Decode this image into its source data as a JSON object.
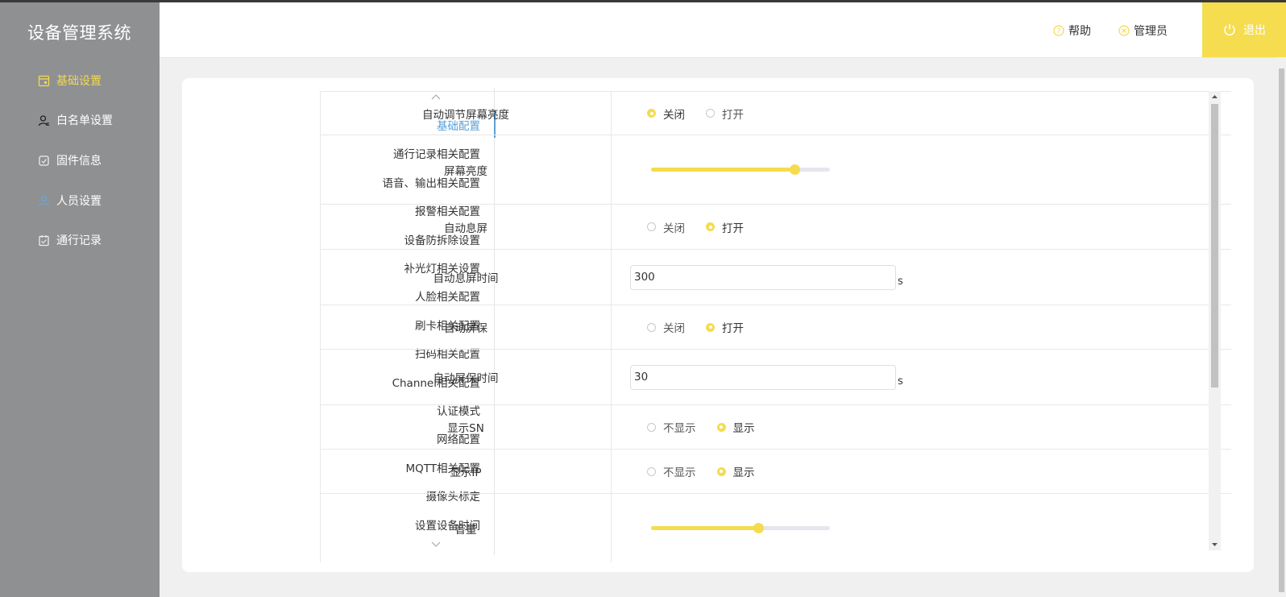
{
  "app": {
    "title": "设备管理系统"
  },
  "sidebar": {
    "items": [
      {
        "label": "基础设置",
        "icon": "settings-panel-icon",
        "active": true
      },
      {
        "label": "白名单设置",
        "icon": "user-list-icon",
        "active": false
      },
      {
        "label": "固件信息",
        "icon": "firmware-chip-icon",
        "active": false
      },
      {
        "label": "人员设置",
        "icon": "person-icon",
        "active": false
      },
      {
        "label": "通行记录",
        "icon": "checklist-icon",
        "active": false
      }
    ]
  },
  "header": {
    "help_label": "帮助",
    "admin_label": "管理员",
    "logout_label": "退出"
  },
  "anchors": {
    "items": [
      "基础配置",
      "通行记录相关配置",
      "语音、输出相关配置",
      "报警相关配置",
      "设备防拆除设置",
      "补光灯相关设置",
      "人脸相关配置",
      "刷卡相关配置",
      "扫码相关配置",
      "Channel相关配置",
      "认证模式",
      "网络配置",
      "MQTT相关配置",
      "摄像头标定",
      "设置设备时间"
    ],
    "active_index": 0
  },
  "settings": {
    "rows": [
      {
        "label": "自动调节屏幕亮度",
        "type": "radio",
        "options": [
          "关闭",
          "打开"
        ],
        "selected": 0
      },
      {
        "label": "屏幕亮度",
        "type": "slider",
        "value": 0.8
      },
      {
        "label": "自动息屏",
        "type": "radio",
        "options": [
          "关闭",
          "打开"
        ],
        "selected": 1
      },
      {
        "label": "自动息屏时间",
        "type": "input",
        "value": "300",
        "unit": "s"
      },
      {
        "label": "自动屏保",
        "type": "radio",
        "options": [
          "关闭",
          "打开"
        ],
        "selected": 1
      },
      {
        "label": "自动屏保时间",
        "type": "input",
        "value": "30",
        "unit": "s"
      },
      {
        "label": "显示SN",
        "type": "radio",
        "options": [
          "不显示",
          "显示"
        ],
        "selected": 1
      },
      {
        "label": "显示IP",
        "type": "radio",
        "options": [
          "不显示",
          "显示"
        ],
        "selected": 1
      },
      {
        "label": "音量",
        "type": "slider",
        "value": 0.6
      }
    ]
  },
  "colors": {
    "accent": "#f5dc4e",
    "sidebar_bg": "#8f9091",
    "link_active": "#5aa0d8"
  }
}
